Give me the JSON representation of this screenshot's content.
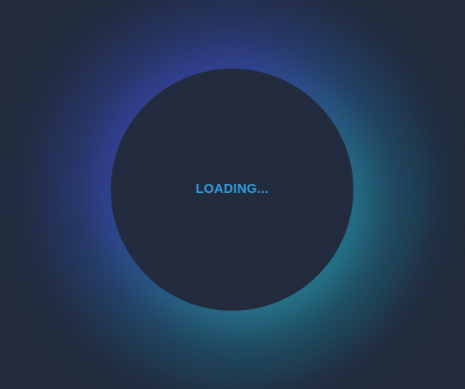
{
  "loader": {
    "label": "LOADING...",
    "accent_color": "#2f9fdf",
    "background_color": "#212b3d",
    "glow_colors": [
      "#3b3fa8",
      "#2a90a0"
    ]
  }
}
